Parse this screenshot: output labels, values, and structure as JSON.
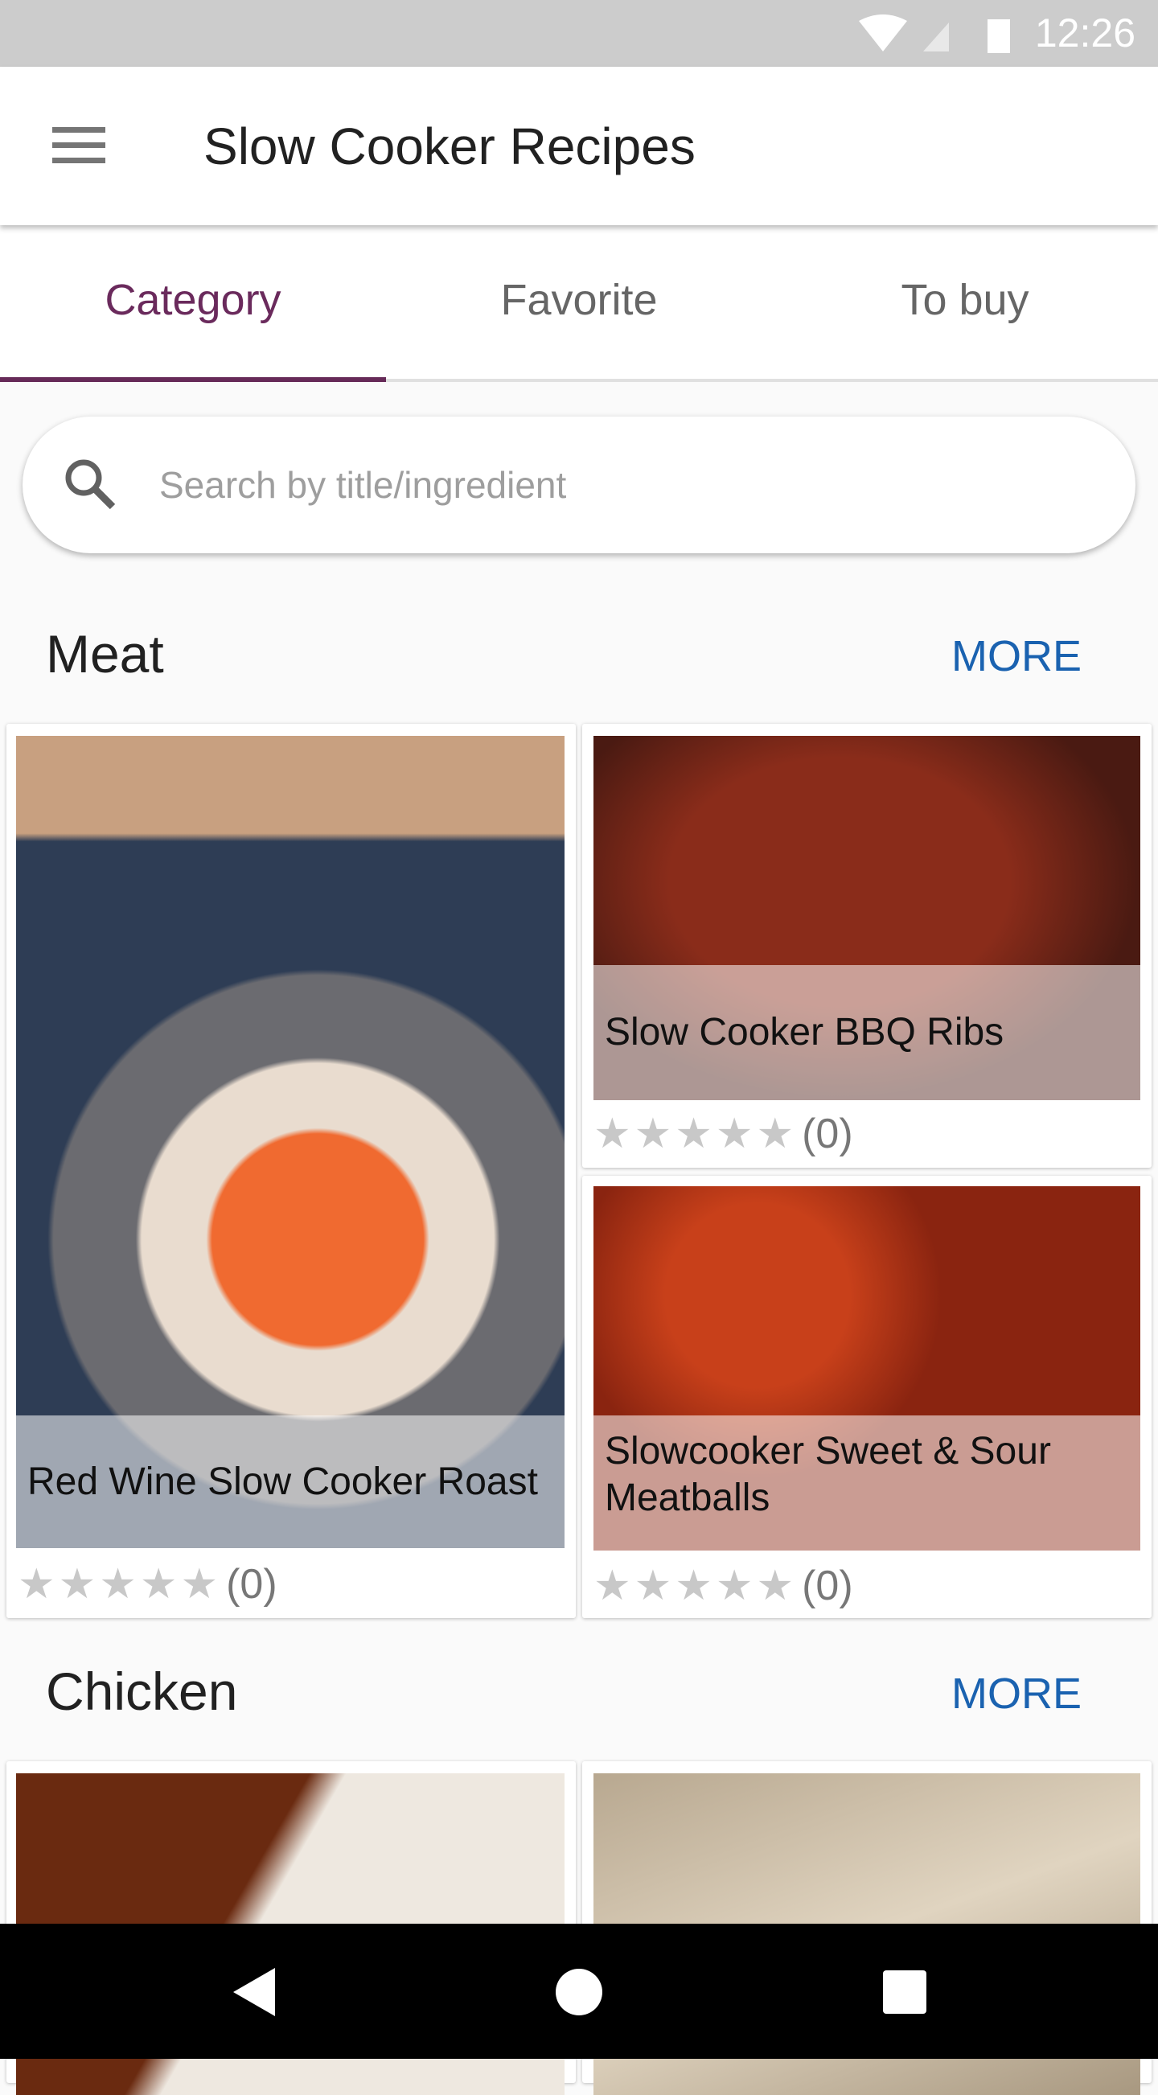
{
  "status": {
    "time": "12:26",
    "icons": [
      "wifi-icon",
      "signal-no-sim-icon",
      "battery-charging-icon"
    ]
  },
  "appbar": {
    "title": "Slow Cooker Recipes",
    "menu_icon": "hamburger-menu-icon"
  },
  "tabs": [
    {
      "label": "Category",
      "active": true
    },
    {
      "label": "Favorite",
      "active": false
    },
    {
      "label": "To buy",
      "active": false
    }
  ],
  "search": {
    "placeholder": "Search by title/ingredient",
    "value": ""
  },
  "sections": [
    {
      "title": "Meat",
      "more": "MORE",
      "recipes": [
        {
          "title": "Red Wine Slow Cooker Roast",
          "rating": 0,
          "count": "(0)"
        },
        {
          "title": "Slow Cooker BBQ Ribs",
          "rating": 0,
          "count": "(0)"
        },
        {
          "title": "Slowcooker Sweet & Sour Meatballs",
          "rating": 0,
          "count": "(0)"
        }
      ]
    },
    {
      "title": "Chicken",
      "more": "MORE"
    }
  ],
  "colors": {
    "accent": "#662a58",
    "link": "#1a62b0"
  },
  "nav": [
    "back-icon",
    "home-icon",
    "recents-icon"
  ]
}
